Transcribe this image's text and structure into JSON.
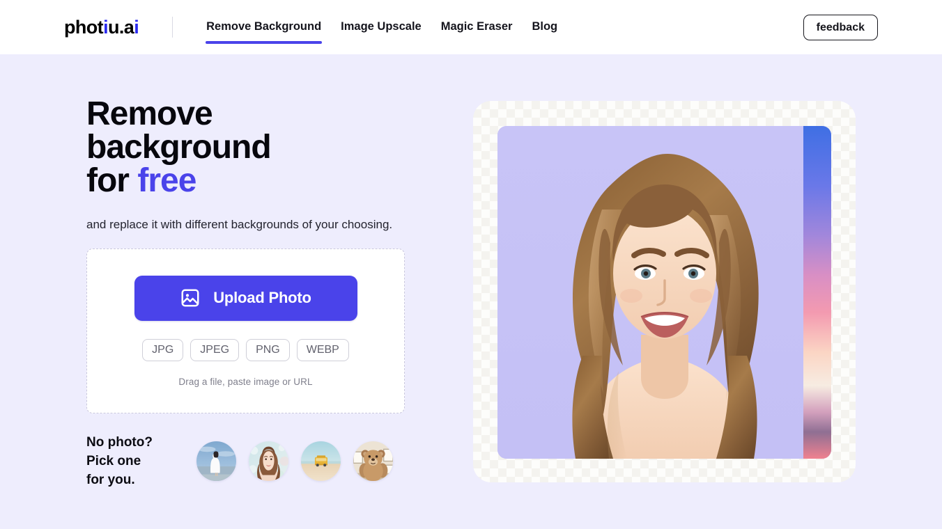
{
  "header": {
    "logo": {
      "text_main": "phot",
      "text_i1": "i",
      "text_u": "u.a",
      "text_i2": "i",
      "full": "photiu.ai"
    },
    "nav": [
      {
        "label": "Remove Background",
        "active": true
      },
      {
        "label": "Image Upscale",
        "active": false
      },
      {
        "label": "Magic Eraser",
        "active": false
      },
      {
        "label": "Blog",
        "active": false
      }
    ],
    "feedback_button": "feedback"
  },
  "hero": {
    "headline_line1": "Remove",
    "headline_line2": "background",
    "headline_line3_prefix": "for ",
    "headline_accent": "free",
    "subhead": "and replace it with different backgrounds of your choosing."
  },
  "uploader": {
    "upload_button_label": "Upload Photo",
    "upload_button_icon": "image-icon",
    "formats": [
      "JPG",
      "JPEG",
      "PNG",
      "WEBP"
    ],
    "drag_hint": "Drag a file,  paste image or URL"
  },
  "samples": {
    "label_line1": "No photo?",
    "label_line2": "Pick one",
    "label_line3": "for you.",
    "thumbnails": [
      {
        "name": "sample-woman-white-dress-beach",
        "alt": "Woman in white dress on a beach"
      },
      {
        "name": "sample-smiling-woman-portrait",
        "alt": "Smiling woman portrait with bokeh"
      },
      {
        "name": "sample-yellow-beach-van",
        "alt": "Yellow van on sandy beach"
      },
      {
        "name": "sample-teddy-bear",
        "alt": "Teddy bear in a room"
      }
    ]
  },
  "preview": {
    "alt": "Smiling young woman with long light-brown hair on lavender background",
    "background_color": "#c6c2f6",
    "strip_alt": "Sunset gradient background preview strip"
  },
  "colors": {
    "accent": "#4a43ea",
    "page_background": "#eeedfd",
    "header_background": "#ffffff",
    "text": "#0b0b12",
    "muted_text": "#7f7f8c",
    "preview_lavender": "#c6c2f6"
  }
}
